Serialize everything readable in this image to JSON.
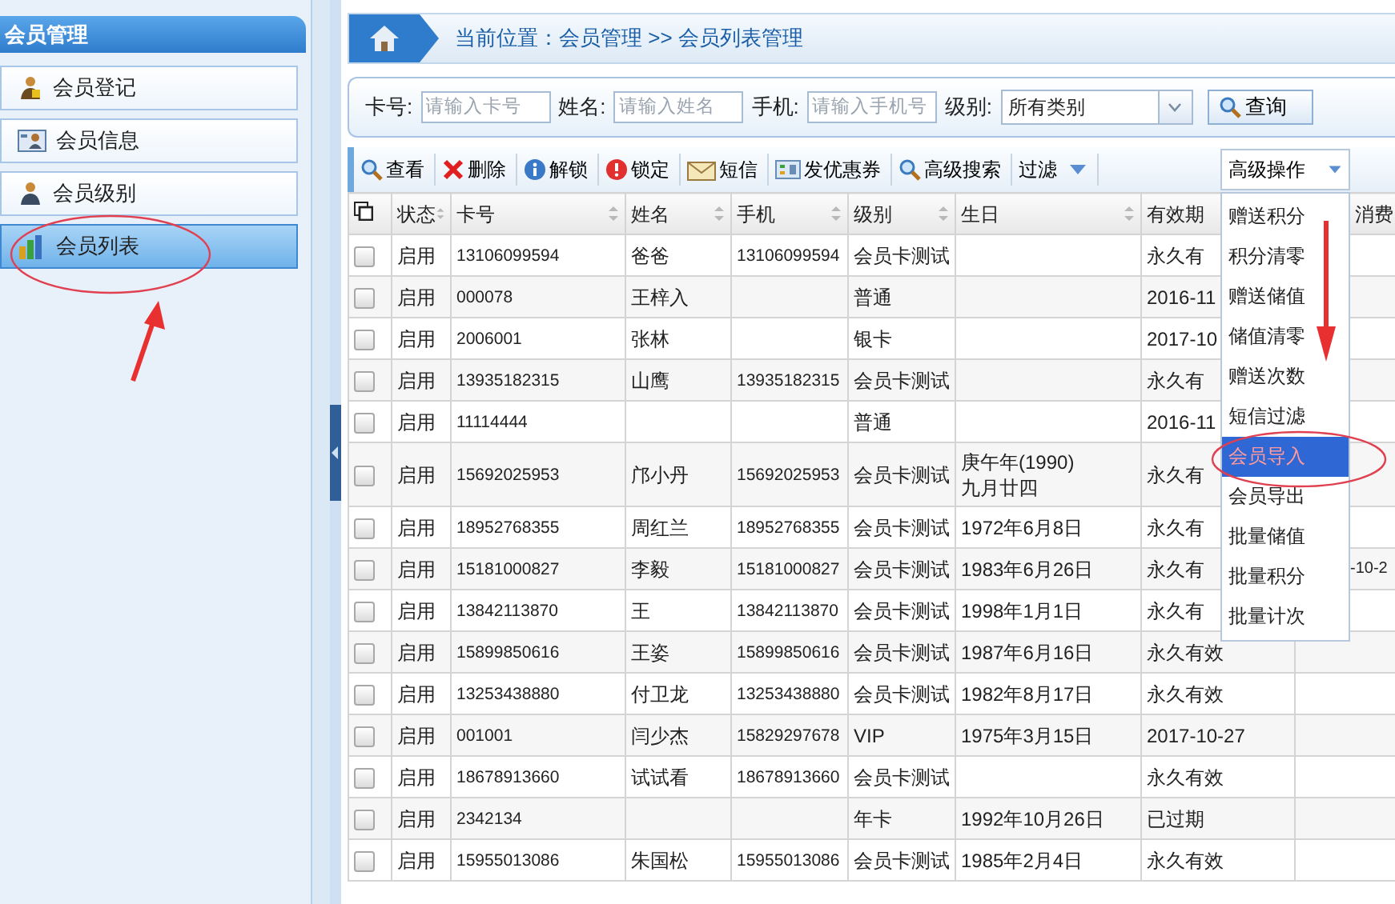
{
  "sidebar": {
    "title": "会员管理",
    "items": [
      {
        "label": "会员登记",
        "kind": "register",
        "selected": false
      },
      {
        "label": "会员信息",
        "kind": "card",
        "selected": false
      },
      {
        "label": "会员级别",
        "kind": "person",
        "selected": false
      },
      {
        "label": "会员列表",
        "kind": "chart",
        "selected": true
      }
    ]
  },
  "breadcrumb": "当前位置：会员管理 >> 会员列表管理",
  "search": {
    "fields": [
      {
        "label": "卡号:",
        "placeholder": "请输入卡号"
      },
      {
        "label": "姓名:",
        "placeholder": "请输入姓名"
      },
      {
        "label": "手机:",
        "placeholder": "请输入手机号"
      }
    ],
    "level": {
      "label": "级别:",
      "value": "所有类别"
    },
    "button": "查询"
  },
  "toolbar": {
    "items": [
      {
        "label": "查看",
        "kind": "search"
      },
      {
        "label": "删除",
        "kind": "delete"
      },
      {
        "label": "解锁",
        "kind": "info"
      },
      {
        "label": "锁定",
        "kind": "alert"
      },
      {
        "label": "短信",
        "kind": "mail"
      },
      {
        "label": "发优惠券",
        "kind": "coupon"
      },
      {
        "label": "高级搜索",
        "kind": "search"
      },
      {
        "label": "过滤",
        "kind": "menu"
      }
    ],
    "advanced": {
      "label": "高级操作",
      "expanded": true,
      "menu": [
        {
          "label": "赠送积分",
          "selected": false
        },
        {
          "label": "积分清零",
          "selected": false
        },
        {
          "label": "赠送储值",
          "selected": false
        },
        {
          "label": "储值清零",
          "selected": false
        },
        {
          "label": "赠送次数",
          "selected": false
        },
        {
          "label": "短信过滤",
          "selected": false
        },
        {
          "label": "会员导入",
          "selected": true
        },
        {
          "label": "会员导出",
          "selected": false
        },
        {
          "label": "批量储值",
          "selected": false
        },
        {
          "label": "批量积分",
          "selected": false
        },
        {
          "label": "批量计次",
          "selected": false
        }
      ]
    }
  },
  "table": {
    "columns": [
      {
        "label": "状态",
        "sortable": true
      },
      {
        "label": "卡号",
        "sortable": true
      },
      {
        "label": "姓名",
        "sortable": true
      },
      {
        "label": "手机",
        "sortable": true
      },
      {
        "label": "级别",
        "sortable": true
      },
      {
        "label": "生日",
        "sortable": true
      },
      {
        "label": "有效期"
      },
      {
        "label": "消费"
      }
    ],
    "rows": [
      {
        "checked": false,
        "cells": [
          "启用",
          "13106099594",
          "爸爸",
          "13106099594",
          "会员卡测试",
          "",
          "永久有",
          ""
        ]
      },
      {
        "checked": false,
        "cells": [
          "启用",
          "000078",
          "王梓入",
          "",
          "普通",
          "",
          "2016-11",
          ""
        ]
      },
      {
        "checked": false,
        "cells": [
          "启用",
          "2006001",
          "张林",
          "",
          "银卡",
          "",
          "2017-10",
          ""
        ]
      },
      {
        "checked": false,
        "cells": [
          "启用",
          "13935182315",
          "山鹰",
          "13935182315",
          "会员卡测试",
          "",
          "永久有",
          ""
        ]
      },
      {
        "checked": false,
        "cells": [
          "启用",
          "11114444",
          "",
          "",
          "普通",
          "",
          "2016-11",
          ""
        ]
      },
      {
        "checked": false,
        "cells": [
          "启用",
          "15692025953",
          "邝小丹",
          "15692025953",
          "会员卡测试",
          "庚午年(1990)\n九月廿四",
          "永久有",
          ""
        ]
      },
      {
        "checked": false,
        "cells": [
          "启用",
          "18952768355",
          "周红兰",
          "18952768355",
          "会员卡测试",
          "1972年6月8日",
          "永久有",
          ""
        ]
      },
      {
        "checked": false,
        "cells": [
          "启用",
          "15181000827",
          "李毅",
          "15181000827",
          "会员卡测试",
          "1983年6月26日",
          "永久有",
          "-10-2"
        ]
      },
      {
        "checked": false,
        "cells": [
          "启用",
          "13842113870",
          "王",
          "13842113870",
          "会员卡测试",
          "1998年1月1日",
          "永久有",
          ""
        ]
      },
      {
        "checked": false,
        "cells": [
          "启用",
          "15899850616",
          "王姿",
          "15899850616",
          "会员卡测试",
          "1987年6月16日",
          "永久有效",
          ""
        ]
      },
      {
        "checked": false,
        "cells": [
          "启用",
          "13253438880",
          "付卫龙",
          "13253438880",
          "会员卡测试",
          "1982年8月17日",
          "永久有效",
          ""
        ]
      },
      {
        "checked": false,
        "cells": [
          "启用",
          "001001",
          "闫少杰",
          "15829297678",
          "VIP",
          "1975年3月15日",
          "2017-10-27",
          ""
        ]
      },
      {
        "checked": false,
        "cells": [
          "启用",
          "18678913660",
          "试试看",
          "18678913660",
          "会员卡测试",
          "",
          "永久有效",
          ""
        ]
      },
      {
        "checked": false,
        "cells": [
          "启用",
          "2342134",
          "",
          "",
          "年卡",
          "1992年10月26日",
          "已过期",
          ""
        ]
      },
      {
        "checked": false,
        "cells": [
          "启用",
          "15955013086",
          "朱国松",
          "15955013086",
          "会员卡测试",
          "1985年2月4日",
          "永久有效",
          ""
        ]
      }
    ]
  }
}
